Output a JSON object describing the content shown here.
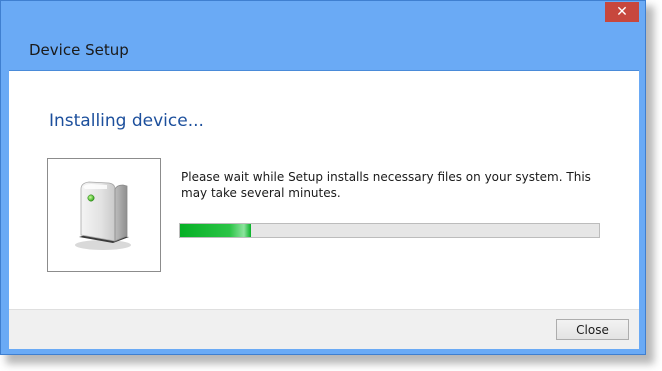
{
  "window": {
    "title": "Device Setup",
    "close_glyph": "✕",
    "close_icon": "close-icon"
  },
  "main": {
    "heading": "Installing device...",
    "device_icon": "device-icon",
    "message": "Please wait while Setup installs necessary files on your system. This may take several minutes.",
    "progress_fraction": 0.17,
    "progress_color": "#06b025"
  },
  "footer": {
    "close_label": "Close"
  },
  "colors": {
    "titlebar": "#6aaaf5",
    "close_button": "#c7473d",
    "heading": "#1c4f9c"
  }
}
